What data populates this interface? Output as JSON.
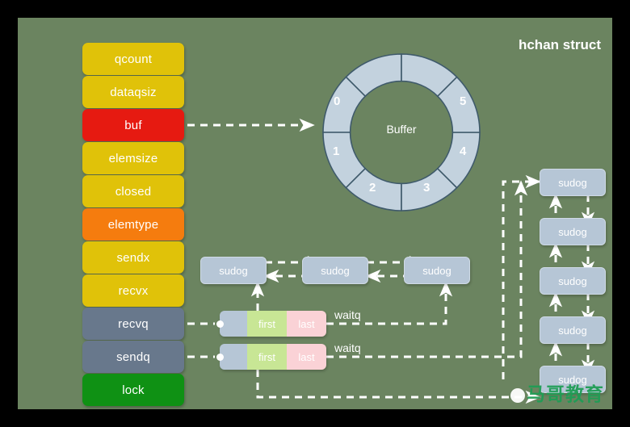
{
  "page": {
    "title": "hchan struct",
    "background_color": "#6b8460",
    "frame_color": "#000000"
  },
  "struct_fields": [
    {
      "label": "qcount",
      "color": "#e0c209",
      "text_color": "#ffffff"
    },
    {
      "label": "dataqsiz",
      "color": "#e0c209",
      "text_color": "#ffffff"
    },
    {
      "label": "buf",
      "color": "#e61a11",
      "text_color": "#ffffff"
    },
    {
      "label": "elemsize",
      "color": "#e0c209",
      "text_color": "#ffffff"
    },
    {
      "label": "closed",
      "color": "#e0c209",
      "text_color": "#ffffff"
    },
    {
      "label": "elemtype",
      "color": "#f57c0e",
      "text_color": "#ffffff"
    },
    {
      "label": "sendx",
      "color": "#e0c209",
      "text_color": "#ffffff"
    },
    {
      "label": "recvx",
      "color": "#e0c209",
      "text_color": "#ffffff"
    },
    {
      "label": "recvq",
      "color": "#68788c",
      "text_color": "#ffffff"
    },
    {
      "label": "sendq",
      "color": "#68788c",
      "text_color": "#ffffff"
    },
    {
      "label": "lock",
      "color": "#0f9114",
      "text_color": "#ffffff"
    }
  ],
  "buffer_ring": {
    "center_label": "Buffer",
    "segments": 8,
    "slot_labels": [
      "0",
      "1",
      "2",
      "3",
      "4",
      "5"
    ],
    "fill_color": "#c3d2de",
    "stroke_color": "#3f5a6b"
  },
  "waitq_rows": [
    {
      "source_field": "recvq",
      "edge_label": "waitq",
      "first_label": "first",
      "last_label": "last"
    },
    {
      "source_field": "sendq",
      "edge_label": "waitq",
      "first_label": "first",
      "last_label": "last"
    }
  ],
  "recvq_chain": {
    "node_label": "sudog",
    "nodes": [
      "sudog",
      "sudog",
      "sudog"
    ]
  },
  "sendq_chain": {
    "node_label": "sudog",
    "nodes": [
      "sudog",
      "sudog",
      "sudog",
      "sudog",
      "sudog"
    ]
  },
  "watermark": {
    "text": "马哥教育",
    "color": "#1f9d55"
  }
}
